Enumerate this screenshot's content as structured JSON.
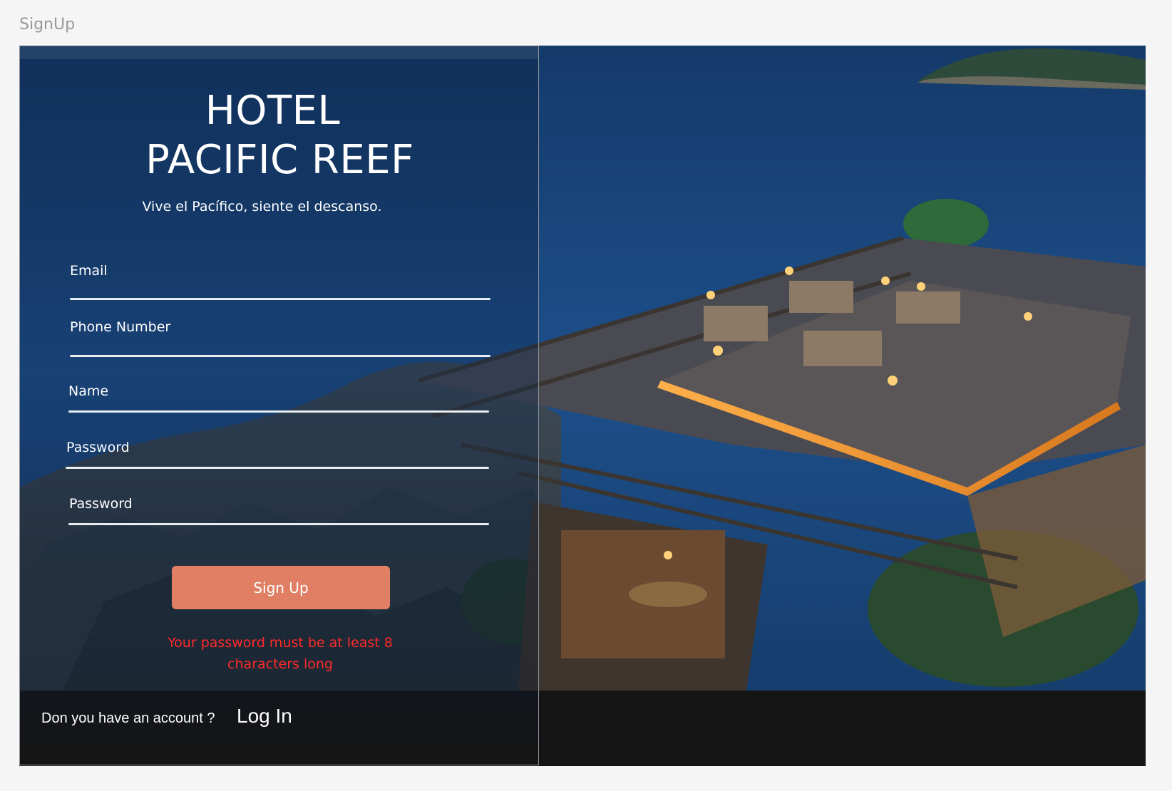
{
  "window": {
    "frame_label": "SignUp"
  },
  "brand": {
    "title_line1": "HOTEL",
    "title_line2": "PACIFIC REEF",
    "tagline": "Vive el Pacífico, siente el descanso."
  },
  "form": {
    "fields": [
      {
        "label": "Email",
        "value": ""
      },
      {
        "label": "Phone Number",
        "value": ""
      },
      {
        "label": "Name",
        "value": ""
      },
      {
        "label": "Password",
        "value": ""
      },
      {
        "label": "Password",
        "value": ""
      }
    ],
    "submit_label": "Sign Up",
    "error_message": "Your password must be at least 8 characters long"
  },
  "footer": {
    "account_question": "Don you have an account ?",
    "login_label": "Log In"
  },
  "colors": {
    "button": "#e07f63",
    "error": "#ff2a2a",
    "footer": "#161515",
    "sea": "#1e4c86"
  },
  "background_image": {
    "subject": "hotel-clifftop-deck-at-dusk"
  }
}
